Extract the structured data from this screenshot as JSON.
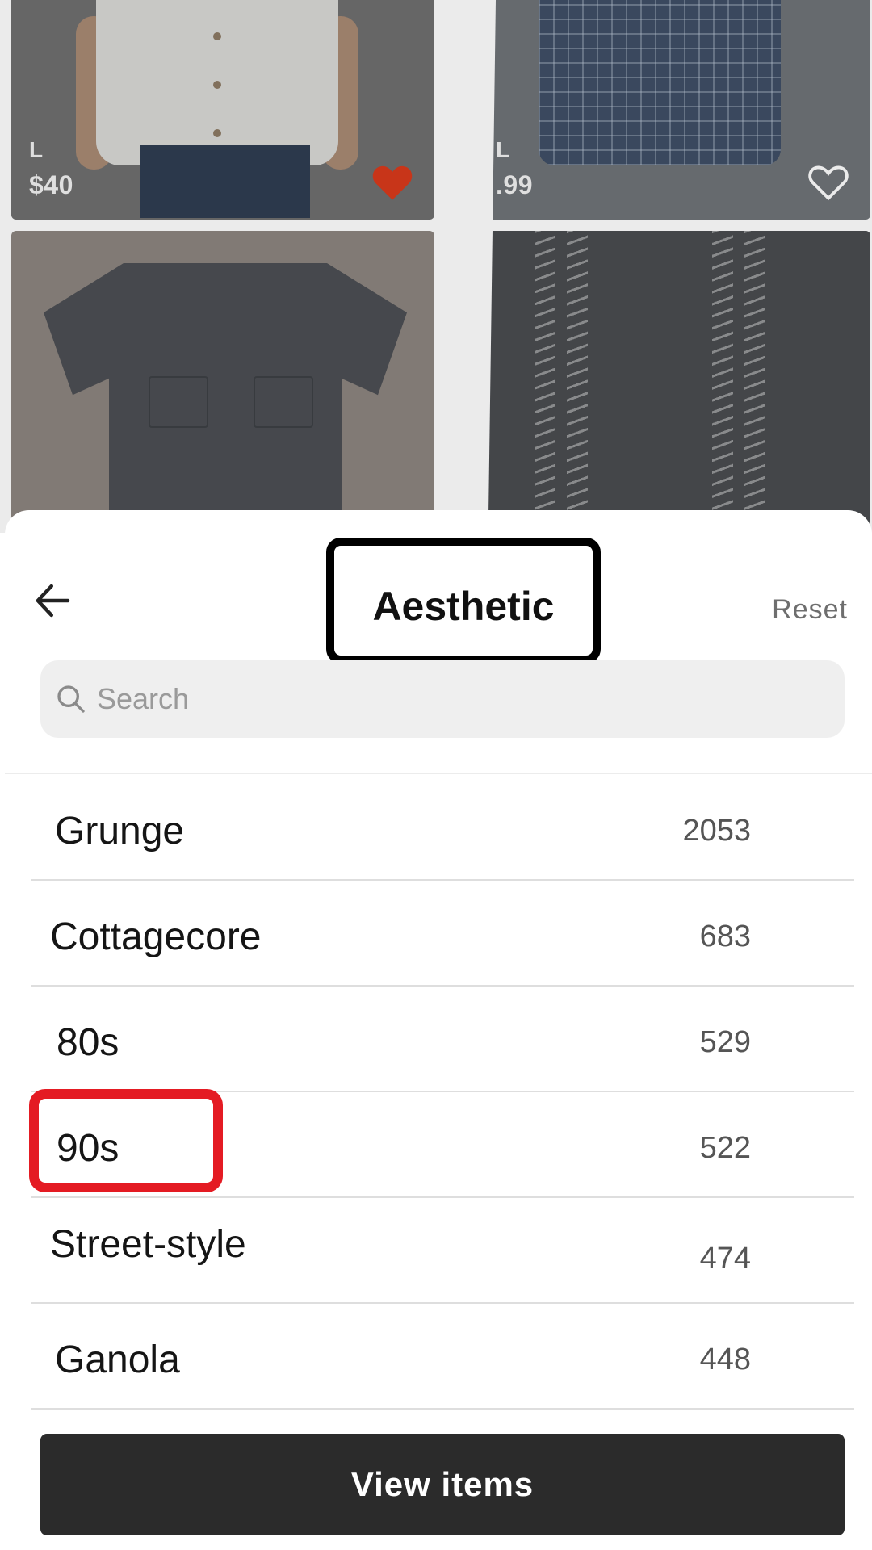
{
  "products": [
    {
      "size": "L",
      "price": "$40",
      "favorited": true,
      "heart_color": "#d93a1c"
    },
    {
      "size": "L",
      "price": ".99",
      "favorited": false,
      "heart_color": "#ffffff"
    },
    {
      "size": "",
      "price": "",
      "favorited": false
    },
    {
      "size": "",
      "price": "",
      "favorited": false
    }
  ],
  "sheet": {
    "title": "Aesthetic",
    "reset_label": "Reset",
    "search_placeholder": "Search",
    "search_value": "",
    "items": [
      {
        "label": "Grunge",
        "count": "2053"
      },
      {
        "label": "Cottagecore",
        "count": "683"
      },
      {
        "label": "80s",
        "count": "529"
      },
      {
        "label": "90s",
        "count": "522",
        "highlighted": true
      },
      {
        "label": "Street-style",
        "count": "474"
      },
      {
        "label": "Ganola",
        "count": "448"
      }
    ],
    "view_button_label": "View items"
  },
  "colors": {
    "highlight_box": "#e41b23",
    "title_box": "#000000",
    "button_bg": "#2b2b2b"
  }
}
